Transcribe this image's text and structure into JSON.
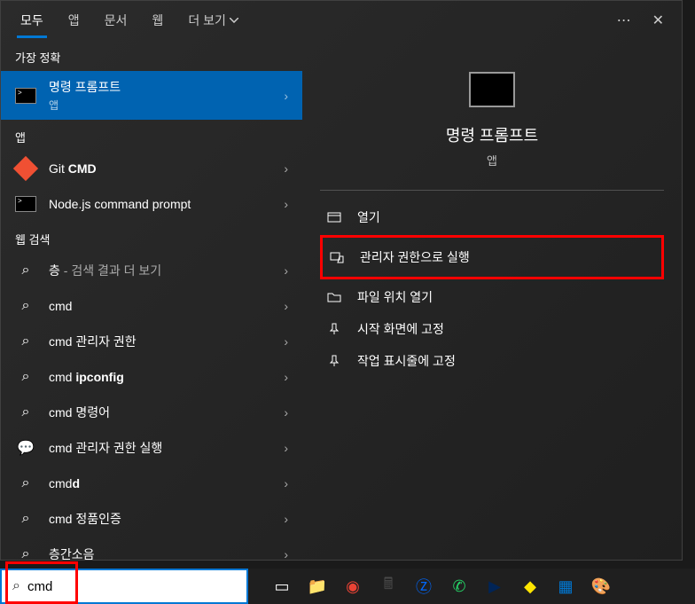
{
  "tabs": {
    "items": [
      "모두",
      "앱",
      "문서",
      "웹",
      "더 보기"
    ],
    "active_index": 0,
    "more_menu_symbol": "⋯",
    "close_symbol": "✕"
  },
  "sections": {
    "best_match": "가장 정확",
    "apps": "앱",
    "web": "웹 검색"
  },
  "best_match": {
    "title": "명령 프롬프트",
    "subtitle": "앱"
  },
  "app_results": [
    {
      "icon": "git",
      "prefix": "Git ",
      "bold": "CMD"
    },
    {
      "icon": "terminal",
      "prefix": "Node.js command prompt",
      "bold": ""
    }
  ],
  "web_results": [
    {
      "icon": "search",
      "prefix": "층",
      "suffix": " - 검색 결과 더 보기"
    },
    {
      "icon": "search",
      "prefix": "cmd",
      "suffix": ""
    },
    {
      "icon": "search",
      "prefix": "cmd 관리자 권한",
      "suffix": ""
    },
    {
      "icon": "search",
      "prefix": "cmd ",
      "bold": "ipconfig"
    },
    {
      "icon": "search",
      "prefix": "cmd 명령어",
      "suffix": ""
    },
    {
      "icon": "chat",
      "prefix": "cmd 관리자 권한 실행",
      "suffix": ""
    },
    {
      "icon": "search",
      "prefix": "cmd",
      "bold": "d"
    },
    {
      "icon": "search",
      "prefix": "cmd 정품인증",
      "suffix": ""
    },
    {
      "icon": "search",
      "prefix": "층간소음",
      "suffix": ""
    }
  ],
  "preview": {
    "title": "명령 프롬프트",
    "subtitle": "앱",
    "actions": [
      {
        "icon": "open",
        "label": "열기"
      },
      {
        "icon": "admin",
        "label": "관리자 권한으로 실행",
        "highlighted": true
      },
      {
        "icon": "folder",
        "label": "파일 위치 열기"
      },
      {
        "icon": "pin",
        "label": "시작 화면에 고정"
      },
      {
        "icon": "pin",
        "label": "작업 표시줄에 고정"
      }
    ]
  },
  "search_input": {
    "value": "cmd",
    "placeholder": ""
  },
  "taskbar_icons": [
    {
      "name": "task-view",
      "color": "#fff",
      "glyph": "▭"
    },
    {
      "name": "file-explorer",
      "color": "#ffcc4d",
      "glyph": "📁"
    },
    {
      "name": "chrome",
      "color": "#ea4335",
      "glyph": "◉"
    },
    {
      "name": "calculator",
      "color": "#4a4a4a",
      "glyph": "🖩"
    },
    {
      "name": "zalo",
      "color": "#0068ff",
      "glyph": "Ⓩ"
    },
    {
      "name": "whatsapp",
      "color": "#25d366",
      "glyph": "✆"
    },
    {
      "name": "powershell",
      "color": "#012456",
      "glyph": "▶"
    },
    {
      "name": "kakaotalk",
      "color": "#fee500",
      "glyph": "◆"
    },
    {
      "name": "app-blue",
      "color": "#0078d4",
      "glyph": "▦"
    },
    {
      "name": "paint",
      "color": "#8b4513",
      "glyph": "🎨"
    }
  ]
}
